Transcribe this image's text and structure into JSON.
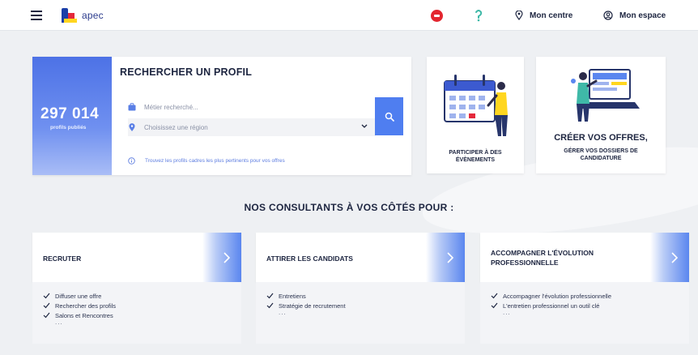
{
  "header": {
    "logo_text": "apec",
    "centre_label": "Mon centre",
    "espace_label": "Mon espace"
  },
  "search": {
    "stat_count": "297 014",
    "stat_label": "profils publiés",
    "title": "RECHERCHER UN PROFIL",
    "job_placeholder": "Métier recherché...",
    "region_placeholder": "Choisissez une région",
    "hint": "Trouvez les profils cadres les plus pertinents pour vos offres"
  },
  "events_card": {
    "line1": "PARTICIPER À DES",
    "line2": "ÉVÈNEMENTS"
  },
  "offers_card": {
    "title": "CRÉER VOS OFFRES,",
    "subtitle_line1": "GÉRER VOS DOSSIERS DE",
    "subtitle_line2": "CANDIDATURE"
  },
  "consultants": {
    "heading": "NOS CONSULTANTS À VOS CÔTÉS POUR :",
    "services": [
      {
        "title_line1": "RECRUTER",
        "title_line2": "",
        "items": [
          "Diffuser une offre",
          "Rechercher des profils",
          "Salons et Rencontres"
        ],
        "more": "..."
      },
      {
        "title_line1": "ATTIRER LES CANDIDATS",
        "title_line2": "",
        "items": [
          "Entretiens",
          "Stratégie de recrutement"
        ],
        "more": "..."
      },
      {
        "title_line1": "ACCOMPAGNER L'ÉVOLUTION",
        "title_line2": "PROFESSIONNELLE",
        "items": [
          "Accompagner l'évolution professionnelle",
          "L'entretien professionnel un outil clé"
        ],
        "more": "..."
      }
    ]
  },
  "colors": {
    "accent": "#4f7ef0",
    "dark_text": "#1d2540",
    "logo_blue": "#1b3fa8",
    "logo_red": "#e4283b",
    "logo_yellow": "#ffd61f",
    "alert_red": "#e3262f",
    "help_green": "#3fb9a8"
  },
  "icons": {
    "menu": "hamburger-icon",
    "alert": "alert-badge-icon",
    "help": "help-icon",
    "centre": "location-pin-icon",
    "espace": "user-circle-icon",
    "search": "magnifier-icon",
    "job": "briefcase-icon",
    "region": "location-pin-icon",
    "hint": "info-circle-icon",
    "service_arrow": "chevron-right-icon",
    "check": "check-icon"
  }
}
